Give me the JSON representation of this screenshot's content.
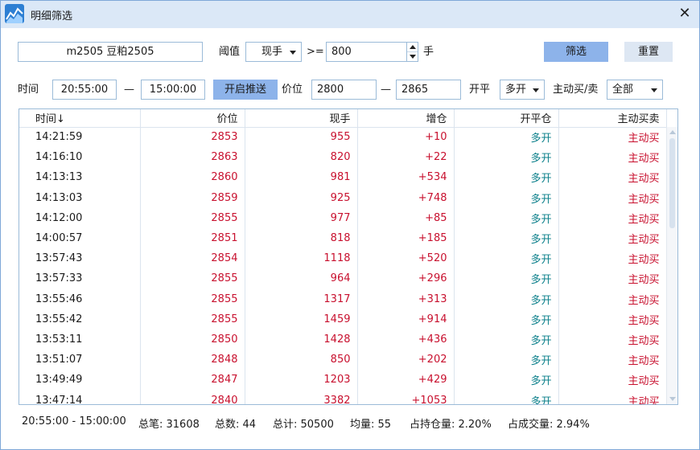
{
  "window": {
    "title": "明细筛选",
    "close": "✕"
  },
  "filter": {
    "contract": "m2505 豆粕2505",
    "threshold_label": "阈值",
    "threshold_type": "现手",
    "operator": ">=",
    "threshold_value": "800",
    "unit": "手",
    "filter_btn": "筛选",
    "reset_btn": "重置"
  },
  "range": {
    "time_label": "时间",
    "time_start": "20:55:00",
    "dash": "—",
    "time_end": "15:00:00",
    "push_btn": "开启推送",
    "price_label": "价位",
    "price_min": "2800",
    "price_max": "2865",
    "open_label": "开平",
    "open_value": "多开",
    "side_label": "主动买/卖",
    "side_value": "全部"
  },
  "table": {
    "headers": [
      "时间↓",
      "价位",
      "现手",
      "增仓",
      "开平仓",
      "主动买卖"
    ],
    "rows": [
      [
        "14:21:59",
        "2853",
        "955",
        "+10",
        "多开",
        "主动买"
      ],
      [
        "14:16:10",
        "2863",
        "820",
        "+22",
        "多开",
        "主动买"
      ],
      [
        "14:13:13",
        "2860",
        "981",
        "+534",
        "多开",
        "主动买"
      ],
      [
        "14:13:03",
        "2859",
        "925",
        "+748",
        "多开",
        "主动买"
      ],
      [
        "14:12:00",
        "2855",
        "977",
        "+85",
        "多开",
        "主动买"
      ],
      [
        "14:00:57",
        "2851",
        "818",
        "+185",
        "多开",
        "主动买"
      ],
      [
        "13:57:43",
        "2854",
        "1118",
        "+520",
        "多开",
        "主动买"
      ],
      [
        "13:57:33",
        "2855",
        "964",
        "+296",
        "多开",
        "主动买"
      ],
      [
        "13:55:46",
        "2855",
        "1317",
        "+313",
        "多开",
        "主动买"
      ],
      [
        "13:55:42",
        "2855",
        "1459",
        "+914",
        "多开",
        "主动买"
      ],
      [
        "13:53:11",
        "2850",
        "1428",
        "+436",
        "多开",
        "主动买"
      ],
      [
        "13:51:07",
        "2848",
        "850",
        "+202",
        "多开",
        "主动买"
      ],
      [
        "13:49:49",
        "2847",
        "1203",
        "+429",
        "多开",
        "主动买"
      ],
      [
        "13:47:14",
        "2840",
        "3382",
        "+1053",
        "多开",
        "主动买"
      ]
    ]
  },
  "footer": {
    "time_range": "20:55:00 - 15:00:00",
    "total_trades": "总笔: 31608",
    "total_count": "总数: 44",
    "total_sum": "总计: 50500",
    "average": "均量: 55",
    "oi_ratio": "占持仓量: 2.20%",
    "vol_ratio": "占成交量: 2.94%"
  },
  "colors": {
    "price": "#c8102e",
    "open": "#0a7f8a",
    "accent_btn": "#8db3ea",
    "titlebar": "#dbe8f7"
  },
  "icons": {
    "app": "chart-line-icon",
    "close": "close-icon",
    "dropdown": "chevron-down-icon",
    "spinner": "spinner-arrows-icon"
  }
}
